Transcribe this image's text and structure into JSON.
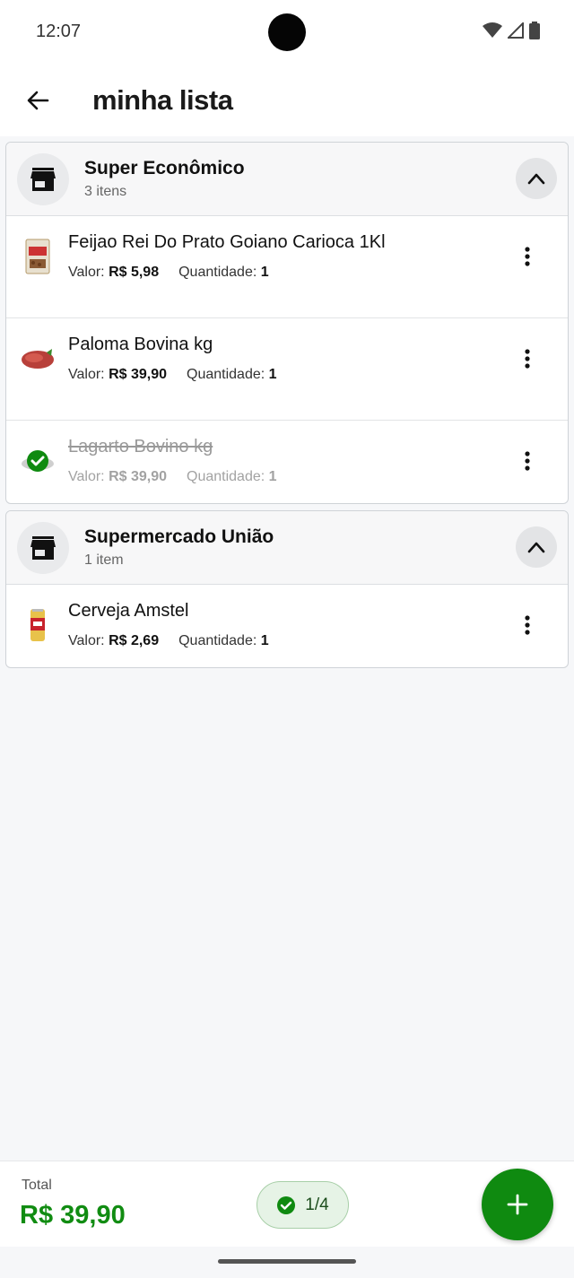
{
  "status_bar": {
    "time": "12:07"
  },
  "app_bar": {
    "title": "minha lista"
  },
  "stores": [
    {
      "name": "Super Econômico",
      "count": "3 itens",
      "items": [
        {
          "name": "Feijao Rei Do Prato Goiano Carioca 1Kl",
          "valor_label": "Valor:",
          "valor": "R$ 5,98",
          "qtd_label": "Quantidade:",
          "qtd": "1",
          "checked": false,
          "thumb_icon": "bean-bag-icon"
        },
        {
          "name": "Paloma Bovina kg",
          "valor_label": "Valor:",
          "valor": "R$ 39,90",
          "qtd_label": "Quantidade:",
          "qtd": "1",
          "checked": false,
          "thumb_icon": "meat-icon"
        },
        {
          "name": "Lagarto Bovino kg",
          "valor_label": "Valor:",
          "valor": "R$ 39,90",
          "qtd_label": "Quantidade:",
          "qtd": "1",
          "checked": true,
          "thumb_icon": "checked-circle-icon"
        }
      ]
    },
    {
      "name": "Supermercado União",
      "count": "1 item",
      "items": [
        {
          "name": "Cerveja Amstel",
          "valor_label": "Valor:",
          "valor": "R$ 2,69",
          "qtd_label": "Quantidade:",
          "qtd": "1",
          "checked": false,
          "thumb_icon": "beer-can-icon"
        }
      ]
    }
  ],
  "footer": {
    "total_label": "Total",
    "total_value": "R$ 39,90",
    "progress": "1/4"
  },
  "colors": {
    "accent": "#0f8a10",
    "total": "#118c12",
    "progress_bg": "#e6f3e6"
  }
}
